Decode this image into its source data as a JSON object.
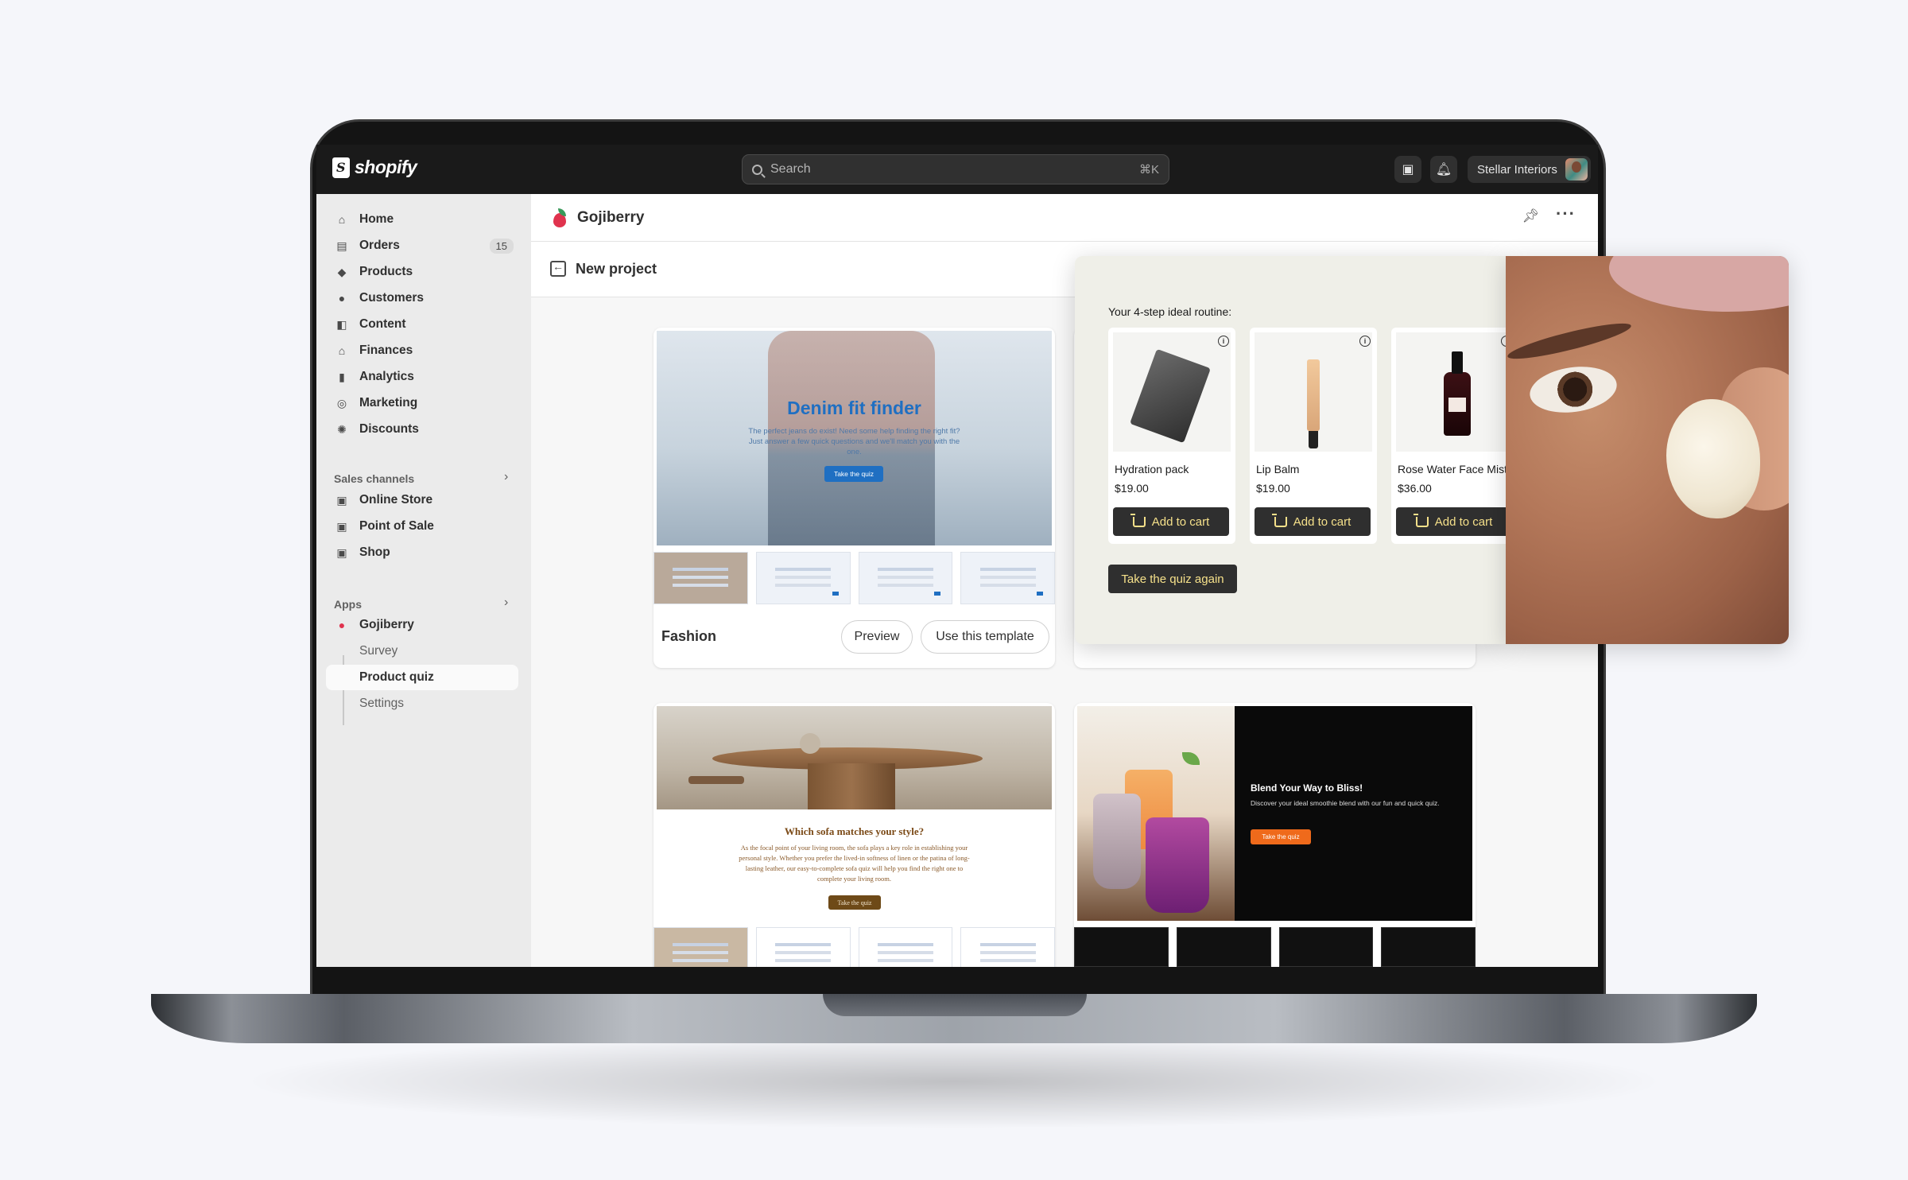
{
  "topbar": {
    "logo_text": "shopify",
    "search_placeholder": "Search",
    "search_shortcut": "⌘K",
    "store_name": "Stellar Interiors"
  },
  "sidebar": {
    "items": [
      {
        "label": "Home",
        "icon": "home-icon"
      },
      {
        "label": "Orders",
        "icon": "inbox-icon",
        "badge": "15"
      },
      {
        "label": "Products",
        "icon": "tag-icon"
      },
      {
        "label": "Customers",
        "icon": "person-icon"
      },
      {
        "label": "Content",
        "icon": "content-icon"
      },
      {
        "label": "Finances",
        "icon": "bank-icon"
      },
      {
        "label": "Analytics",
        "icon": "bar-chart-icon"
      },
      {
        "label": "Marketing",
        "icon": "target-icon"
      },
      {
        "label": "Discounts",
        "icon": "discount-icon"
      }
    ],
    "sales_channels_title": "Sales channels",
    "sales_channels": [
      {
        "label": "Online Store",
        "icon": "store-icon"
      },
      {
        "label": "Point of Sale",
        "icon": "pos-icon"
      },
      {
        "label": "Shop",
        "icon": "shop-icon"
      }
    ],
    "apps_title": "Apps",
    "app_name": "Gojiberry",
    "app_sub_items": [
      {
        "label": "Survey"
      },
      {
        "label": "Product quiz"
      },
      {
        "label": "Settings"
      }
    ]
  },
  "main": {
    "app_title": "Gojiberry",
    "page_title": "New project",
    "templates": [
      {
        "name": "Fashion",
        "preview_label": "Preview",
        "use_label": "Use this template",
        "hero_title": "Denim fit finder",
        "hero_text": "The perfect jeans do exist! Need some help finding the right fit? Just answer a few quick questions and we'll match you with the one.",
        "hero_button": "Take the quiz"
      },
      {
        "hero_title": "Which sofa matches your style?",
        "hero_text": "As the focal point of your living room, the sofa plays a key role in establishing your personal style. Whether you prefer the lived-in softness of linen or the patina of long-lasting leather, our easy-to-complete sofa quiz will help you find the right one to complete your living room.",
        "hero_button": "Take the quiz"
      },
      {
        "hero_title": "Blend Your Way to Bliss!",
        "hero_text": "Discover your ideal smoothie blend with our fun and quick quiz.",
        "hero_button": "Take the quiz"
      }
    ]
  },
  "quiz_popup": {
    "heading": "Your 4-step ideal routine:",
    "products": [
      {
        "name": "Hydration pack",
        "price": "$19.00",
        "button": "Add to cart"
      },
      {
        "name": "Lip Balm",
        "price": "$19.00",
        "button": "Add to cart"
      },
      {
        "name": "Rose Water Face Mist",
        "price": "$36.00",
        "button": "Add to cart"
      }
    ],
    "retake_label": "Take the quiz again"
  },
  "colors": {
    "topbar": "#1a1a1a",
    "sidebar": "#ebebeb",
    "accent_blue": "#1f6fc2",
    "cart_button": "#2f2f2f",
    "cart_text": "#f5e08a"
  }
}
